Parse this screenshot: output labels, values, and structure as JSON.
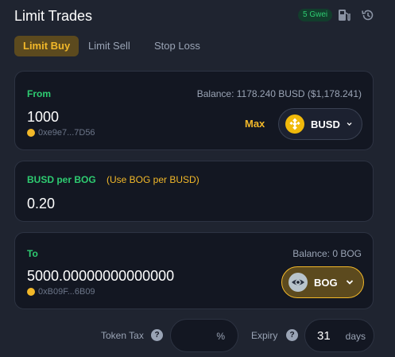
{
  "header": {
    "title": "Limit Trades",
    "gas_badge": "5 Gwei",
    "icons": [
      "fuel-pump-icon",
      "history-icon"
    ]
  },
  "tabs": [
    {
      "label": "Limit Buy",
      "active": true
    },
    {
      "label": "Limit Sell",
      "active": false
    },
    {
      "label": "Stop Loss",
      "active": false
    }
  ],
  "from": {
    "label": "From",
    "balance": "Balance: 1178.240 BUSD ($1,178.241)",
    "amount": "1000",
    "address": "0xe9e7...7D56",
    "max_label": "Max",
    "token": "BUSD"
  },
  "price": {
    "label": "BUSD per BOG",
    "toggle_label": "(Use BOG per BUSD)",
    "value": "0.20"
  },
  "to": {
    "label": "To",
    "balance": "Balance: 0 BOG",
    "amount": "5000.00000000000000",
    "address": "0xB09F...6B09",
    "token": "BOG"
  },
  "bottom": {
    "token_tax_label": "Token Tax",
    "tax_unit": "%",
    "tax_value": "",
    "expiry_label": "Expiry",
    "expiry_value": "31",
    "expiry_unit": "days"
  },
  "colors": {
    "background": "#1f2430",
    "card": "#131722",
    "accent_gold": "#f2b829",
    "accent_green": "#2ecc71",
    "muted": "#9aa4b5"
  }
}
